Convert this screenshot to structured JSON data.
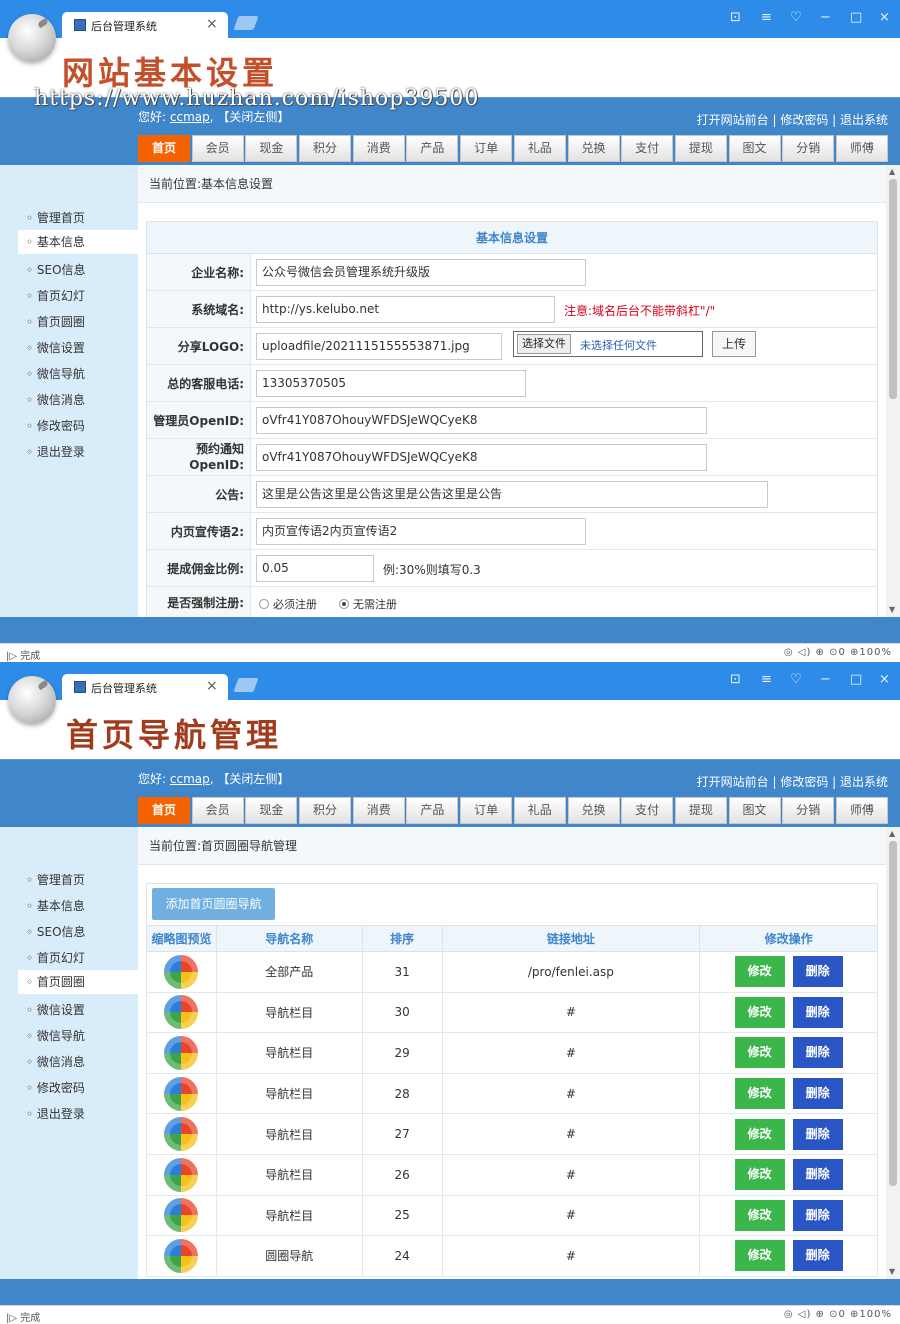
{
  "browser": {
    "tab_title": "后台管理系统",
    "tab_close": "×",
    "window_controls": [
      "⊡",
      "≡",
      "♡",
      "−",
      "□",
      "×"
    ],
    "status_left": "|▷ 完成",
    "status_right": "◎  ◁)  ⊕  ⊙0  ⊕100%"
  },
  "screen1": {
    "banner_title": "网站基本设置",
    "watermark": "https://www.huzhan.com/ishop39500"
  },
  "screen2": {
    "banner_title": "首页导航管理"
  },
  "header": {
    "greeting_prefix": "您好:",
    "user": "ccmap",
    "greeting_suffix": ", 【关闭左侧】",
    "top_links": "打开网站前台 | 修改密码 | 退出系统"
  },
  "nav": [
    "首页",
    "会员",
    "现金",
    "积分",
    "消费",
    "产品",
    "订单",
    "礼品",
    "兑换",
    "支付",
    "提现",
    "图文",
    "分销",
    "师傅"
  ],
  "sidebar": [
    "管理首页",
    "基本信息",
    "SEO信息",
    "首页幻灯",
    "首页圆圈",
    "微信设置",
    "微信导航",
    "微信消息",
    "修改密码",
    "退出登录"
  ],
  "sidebar_bullet": "◦",
  "form": {
    "breadcrumb": "当前位置:基本信息设置",
    "heading": "基本信息设置",
    "company_label": "企业名称:",
    "company_value": "公众号微信会员管理系统升级版",
    "domain_label": "系统域名:",
    "domain_value": "http://ys.kelubo.net",
    "domain_note": "注意:域名后台不能带斜杠\"/\"",
    "logo_label": "分享LOGO:",
    "logo_value": "uploadfile/2021115155553871.jpg",
    "file_button": "选择文件",
    "file_text": "未选择任何文件",
    "upload_button": "上传",
    "phone_label": "总的客服电话:",
    "phone_value": "13305370505",
    "openid_label": "管理员OpenID:",
    "openid_value": "oVfr41Y087OhouyWFDSJeWQCyeK8",
    "notify_label_1": "预约通知",
    "notify_label_2": "OpenID:",
    "notify_value": "oVfr41Y087OhouyWFDSJeWQCyeK8",
    "notice_label": "公告:",
    "notice_value": "这里是公告这里是公告这里是公告这里是公告",
    "slogan_label": "内页宣传语2:",
    "slogan_value": "内页宣传语2内页宣传语2",
    "ratio_label": "提成佣金比例:",
    "ratio_value": "0.05",
    "ratio_note": "例:30%则填写0.3",
    "register_label": "是否强制注册:",
    "register_options": [
      "必须注册",
      "无需注册"
    ],
    "register_selected": "无需注册"
  },
  "navmgr": {
    "breadcrumb": "当前位置:首页圆圈导航管理",
    "add_button": "添加首页圆圈导航",
    "columns": [
      "缩略图预览",
      "导航名称",
      "排序",
      "链接地址",
      "修改操作"
    ],
    "rows": [
      {
        "name": "全部产品",
        "order": "31",
        "link": "/pro/fenlei.asp"
      },
      {
        "name": "导航栏目",
        "order": "30",
        "link": "#"
      },
      {
        "name": "导航栏目",
        "order": "29",
        "link": "#"
      },
      {
        "name": "导航栏目",
        "order": "28",
        "link": "#"
      },
      {
        "name": "导航栏目",
        "order": "27",
        "link": "#"
      },
      {
        "name": "导航栏目",
        "order": "26",
        "link": "#"
      },
      {
        "name": "导航栏目",
        "order": "25",
        "link": "#"
      },
      {
        "name": "圆圈导航",
        "order": "24",
        "link": "#"
      }
    ],
    "edit_label": "修改",
    "delete_label": "删除"
  },
  "colors": {
    "accent_blue": "#3f86cb",
    "nav_active": "#f46300",
    "edit_green": "#3ab64a",
    "delete_blue": "#2a55c4"
  }
}
